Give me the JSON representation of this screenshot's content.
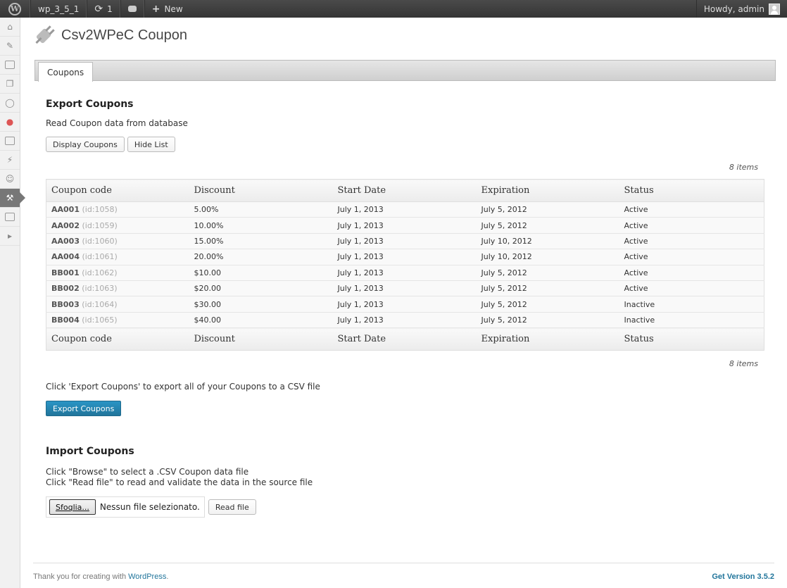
{
  "adminbar": {
    "wp_logo": "wordpress-logo",
    "site_name": "wp_3_5_1",
    "updates_count": "1",
    "new_label": "New",
    "howdy": "Howdy, admin"
  },
  "sidebar": {
    "icons": [
      "dashboard-icon",
      "pin-icon",
      "media-icon",
      "pages-icon",
      "comments-icon",
      "store-icon",
      "appearance-icon",
      "plugins-icon",
      "users-icon",
      "tools-icon",
      "settings-icon",
      "collapse-icon"
    ],
    "current_index": 9
  },
  "page": {
    "title": "Csv2WPeC Coupon",
    "tab": "Coupons"
  },
  "export": {
    "heading": "Export Coupons",
    "description": "Read Coupon data from database",
    "display_button": "Display Coupons",
    "hide_button": "Hide List",
    "items_count": "8 items",
    "columns": [
      "Coupon code",
      "Discount",
      "Start Date",
      "Expiration",
      "Status"
    ],
    "rows": [
      {
        "code": "AA001",
        "id": "(id:1058)",
        "discount": "5.00%",
        "start": "July 1, 2013",
        "expiration": "July 5, 2012",
        "status": "Active"
      },
      {
        "code": "AA002",
        "id": "(id:1059)",
        "discount": "10.00%",
        "start": "July 1, 2013",
        "expiration": "July 5, 2012",
        "status": "Active"
      },
      {
        "code": "AA003",
        "id": "(id:1060)",
        "discount": "15.00%",
        "start": "July 1, 2013",
        "expiration": "July 10, 2012",
        "status": "Active"
      },
      {
        "code": "AA004",
        "id": "(id:1061)",
        "discount": "20.00%",
        "start": "July 1, 2013",
        "expiration": "July 10, 2012",
        "status": "Active"
      },
      {
        "code": "BB001",
        "id": "(id:1062)",
        "discount": "$10.00",
        "start": "July 1, 2013",
        "expiration": "July 5, 2012",
        "status": "Active"
      },
      {
        "code": "BB002",
        "id": "(id:1063)",
        "discount": "$20.00",
        "start": "July 1, 2013",
        "expiration": "July 5, 2012",
        "status": "Active"
      },
      {
        "code": "BB003",
        "id": "(id:1064)",
        "discount": "$30.00",
        "start": "July 1, 2013",
        "expiration": "July 5, 2012",
        "status": "Inactive"
      },
      {
        "code": "BB004",
        "id": "(id:1065)",
        "discount": "$40.00",
        "start": "July 1, 2013",
        "expiration": "July 5, 2012",
        "status": "Inactive"
      }
    ],
    "export_hint": "Click 'Export Coupons' to export all of your Coupons to a CSV file",
    "export_button": "Export Coupons"
  },
  "import": {
    "heading": "Import Coupons",
    "line1": "Click \"Browse\" to select a .CSV Coupon data file",
    "line2": "Click \"Read file\" to read and validate the data in the source file",
    "browse_button": "Sfoglia...",
    "file_name": "Nessun file selezionato.",
    "read_button": "Read file"
  },
  "footer": {
    "thanks": "Thank you for creating with ",
    "wp_link": "WordPress",
    "period": ".",
    "version": "Get Version 3.5.2"
  }
}
